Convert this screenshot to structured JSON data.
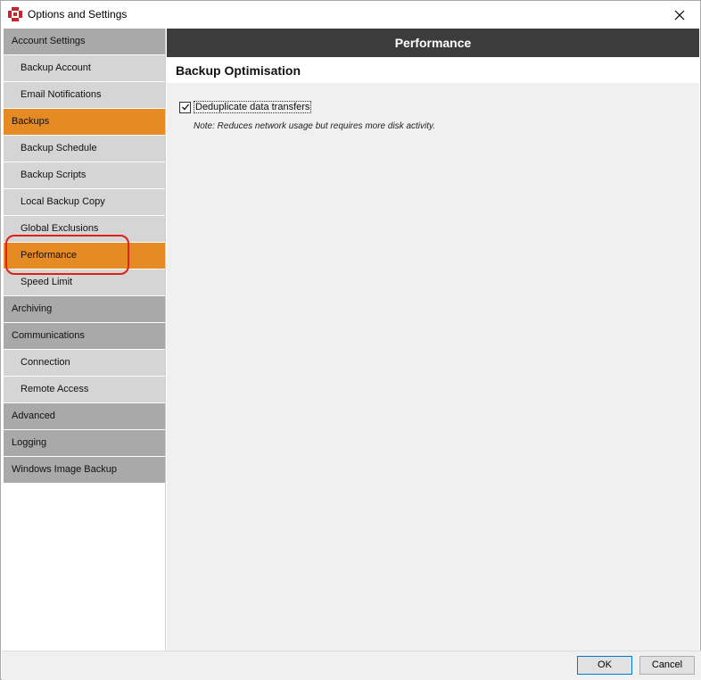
{
  "window": {
    "title": "Options and Settings",
    "close_glyph": "✕"
  },
  "sidebar": {
    "items": [
      {
        "label": "Account Settings",
        "kind": "category",
        "active": false
      },
      {
        "label": "Backup Account",
        "kind": "sub",
        "active": false
      },
      {
        "label": "Email Notifications",
        "kind": "sub",
        "active": false
      },
      {
        "label": "Backups",
        "kind": "category",
        "active": true
      },
      {
        "label": "Backup Schedule",
        "kind": "sub",
        "active": false
      },
      {
        "label": "Backup Scripts",
        "kind": "sub",
        "active": false
      },
      {
        "label": "Local Backup Copy",
        "kind": "sub",
        "active": false
      },
      {
        "label": "Global Exclusions",
        "kind": "sub",
        "active": false
      },
      {
        "label": "Performance",
        "kind": "sub",
        "active": true
      },
      {
        "label": "Speed Limit",
        "kind": "sub",
        "active": false
      },
      {
        "label": "Archiving",
        "kind": "category",
        "active": false
      },
      {
        "label": "Communications",
        "kind": "category",
        "active": false
      },
      {
        "label": "Connection",
        "kind": "sub",
        "active": false
      },
      {
        "label": "Remote Access",
        "kind": "sub",
        "active": false
      },
      {
        "label": "Advanced",
        "kind": "category",
        "active": false
      },
      {
        "label": "Logging",
        "kind": "category",
        "active": false
      },
      {
        "label": "Windows Image Backup",
        "kind": "category",
        "active": false
      }
    ]
  },
  "content": {
    "header": "Performance",
    "section_title": "Backup Optimisation",
    "dedupe": {
      "label": "Deduplicate data transfers",
      "checked": true
    },
    "note": "Note: Reduces network usage but requires more disk activity."
  },
  "footer": {
    "ok_label": "OK",
    "cancel_label": "Cancel"
  },
  "colors": {
    "accent": "#e68a24",
    "header_bg": "#3c3c3c",
    "category_bg": "#a9a9a9",
    "sub_bg": "#d5d5d5",
    "highlight": "#e0201a"
  },
  "icons": {
    "app": "app-logo-icon",
    "close": "close-icon",
    "check": "checkmark-icon"
  }
}
